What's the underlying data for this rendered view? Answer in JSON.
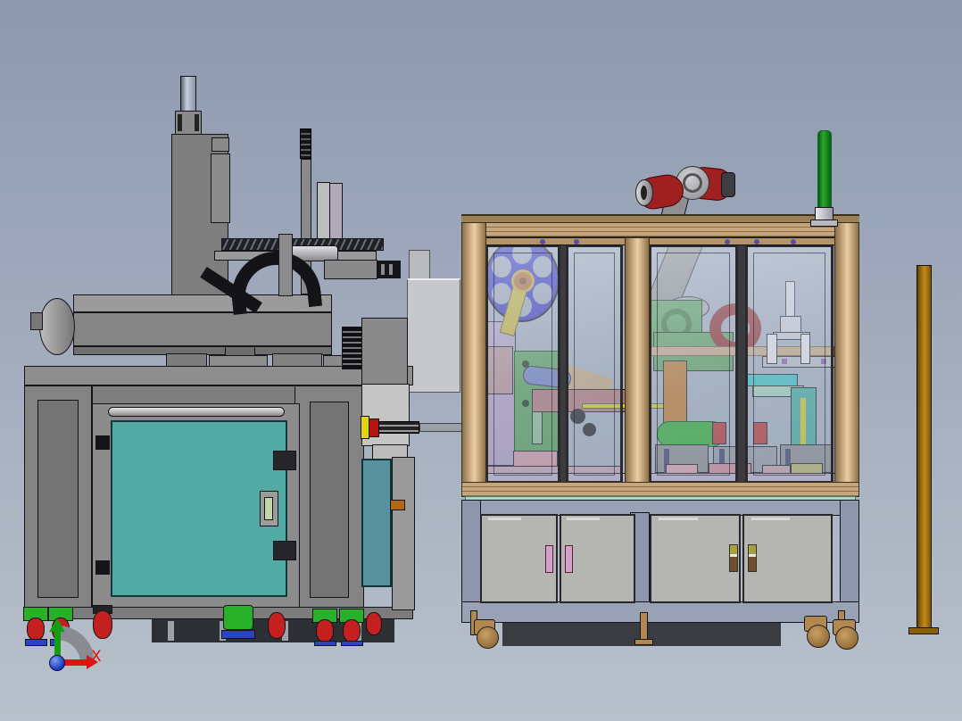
{
  "viewport": {
    "kind": "3d-cad-assembly-view",
    "axis_triad": {
      "x_label": "X"
    }
  },
  "machines": {
    "left": {
      "name": "gantry-loader-machine",
      "parts": [
        "z-axis-cylinder",
        "vertical-tower",
        "cable-tray",
        "drag-chain",
        "gantry-beam",
        "frame-legs",
        "teal-access-door",
        "door-handle",
        "door-hinges",
        "door-latches",
        "side-cabinet",
        "heatsink",
        "connecting-rod",
        "casters",
        "leveling-foot"
      ]
    },
    "right": {
      "name": "enclosed-assembly-cell",
      "parts": [
        "robot-arm",
        "signal-light-tower",
        "aluminum-frame",
        "glass-doors",
        "film-reel",
        "reel-arm",
        "process-fixtures",
        "lower-cabinet",
        "cabinet-doors",
        "cabinet-handles",
        "casters",
        "leveling-foot",
        "floor-shadow"
      ]
    },
    "standalone": {
      "parts": [
        "floor-post"
      ]
    }
  },
  "colors": {
    "bg-top": "#8e99ae",
    "bg-mid": "#a2acbd",
    "bg-bot": "#b8c1cb",
    "steel": "#8a8a8a",
    "steel-mid": "#9b9b9b",
    "steel-dark": "#6f6f6f",
    "steel-light": "#c5c5c8",
    "black-part": "#161618",
    "teal-door": "#53a9a4",
    "teal-side": "#58929c",
    "reel-blue": "#2424be",
    "hub-orange": "#a9611c",
    "hub-gold": "#bf9f28",
    "arm-yellow": "#c3b02a",
    "green-part": "#55a055",
    "green-bright": "#2fae2f",
    "caster-green": "#28b028",
    "caster-red": "#c42020",
    "caster-blue": "#2c42c4",
    "red-part": "#bf2f2f",
    "robot-red": "#9e2020",
    "ring-red": "#8b1f1f",
    "bronze": "#b08850",
    "tan": "#c7a67d",
    "tan-dark": "#8a6f4a",
    "cabinet-blue": "#99a2b4",
    "cabinet-stile": "#8d96aa",
    "door-gray": "#b5b5b1",
    "handle-pink": "#d2a0ca",
    "tower-green": "#2aa82a",
    "pole-brown": "#a87612",
    "shadow": "#393c40",
    "purple-part": "#b5a0c5",
    "lavender": "#beb6d0",
    "mauve": "#b98f92",
    "pink-part": "#d79aa4",
    "pink2": "#d18b95",
    "slide-mauve": "#b57575",
    "cyan-part": "#35c2c2",
    "mint": "#a5d4b8",
    "teal-tool": "#3fae9f",
    "orange-arm": "#bf7728",
    "olive": "#a79f3f",
    "olive2": "#bcb668",
    "white-part": "#e8e8ee",
    "blue-cyl": "#6e7ec0",
    "yellow-cap": "#e3d50a",
    "yellow-rod": "#d6d21c",
    "red-cap": "#b51414",
    "knob-orange": "#b06818",
    "axis-red": "#e01212",
    "axis-green": "#12a012",
    "axis-blue": "#2446c8"
  }
}
